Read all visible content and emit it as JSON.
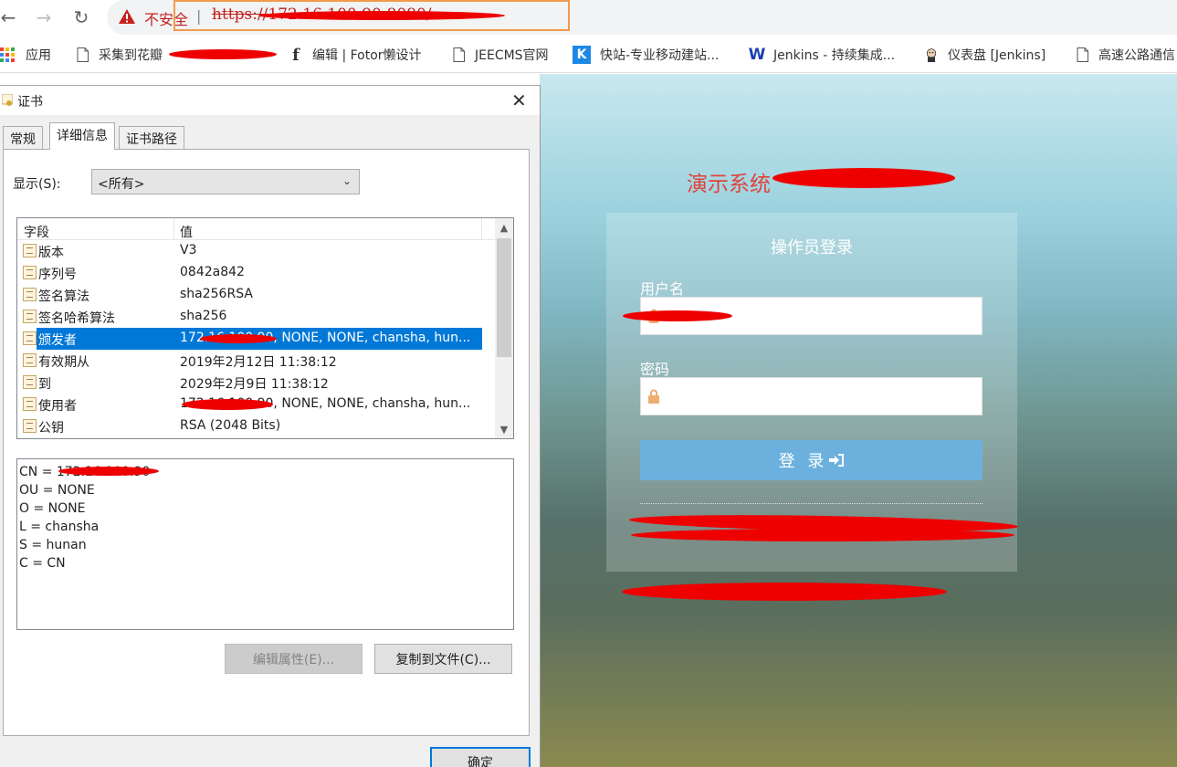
{
  "browser": {
    "security_label": "不安全",
    "separator": "|",
    "url": "https://172.16.100.90:8080/..."
  },
  "bookmarks": [
    {
      "label": "应用",
      "icon": "apps-grid-icon"
    },
    {
      "label": "采集到花瓣",
      "icon": "page-icon"
    },
    {
      "label": "编辑 | Fotor懒设计",
      "icon": "fotor-f-icon"
    },
    {
      "label": "JEECMS官网",
      "icon": "page-icon"
    },
    {
      "label": "快站-专业移动建站...",
      "icon": "kuaizhan-k-icon"
    },
    {
      "label": "Jenkins - 持续集成...",
      "icon": "w-logo-icon"
    },
    {
      "label": "仪表盘 [Jenkins]",
      "icon": "jenkins-avatar-icon"
    },
    {
      "label": "高速公路通信",
      "icon": "page-icon"
    }
  ],
  "login_page": {
    "system_title": "演示系统",
    "login_title": "操作员登录",
    "username_label": "用户名",
    "password_label": "密码",
    "login_button": "登 录",
    "button_color": "#6cb1de",
    "title_color": "#e0433b"
  },
  "cert_dialog": {
    "title": "证书",
    "tabs": [
      "常规",
      "详细信息",
      "证书路径"
    ],
    "show_label": "显示(S):",
    "show_value": "<所有>",
    "columns": [
      "字段",
      "值"
    ],
    "fields": [
      {
        "name": "版本",
        "value": "V3"
      },
      {
        "name": "序列号",
        "value": "0842a842"
      },
      {
        "name": "签名算法",
        "value": "sha256RSA"
      },
      {
        "name": "签名哈希算法",
        "value": "sha256"
      },
      {
        "name": "颁发者",
        "value": "172.16.100.90, NONE, NONE, chansha, hun..."
      },
      {
        "name": "有效期从",
        "value": "2019年2月12日 11:38:12"
      },
      {
        "name": "到",
        "value": "2029年2月9日 11:38:12"
      },
      {
        "name": "使用者",
        "value": "172.16.100.90, NONE, NONE, chansha, hun..."
      },
      {
        "name": "公钥",
        "value": "RSA (2048 Bits)"
      }
    ],
    "selected_index": 4,
    "detail_lines": [
      "CN = 172.16.100.90",
      "OU = NONE",
      "O = NONE",
      "L = chansha",
      "S = hunan",
      "C = CN"
    ],
    "edit_button": "编辑属性(E)...",
    "copy_button": "复制到文件(C)...",
    "ok_button": "确定",
    "selection_color": "#0078d7"
  }
}
